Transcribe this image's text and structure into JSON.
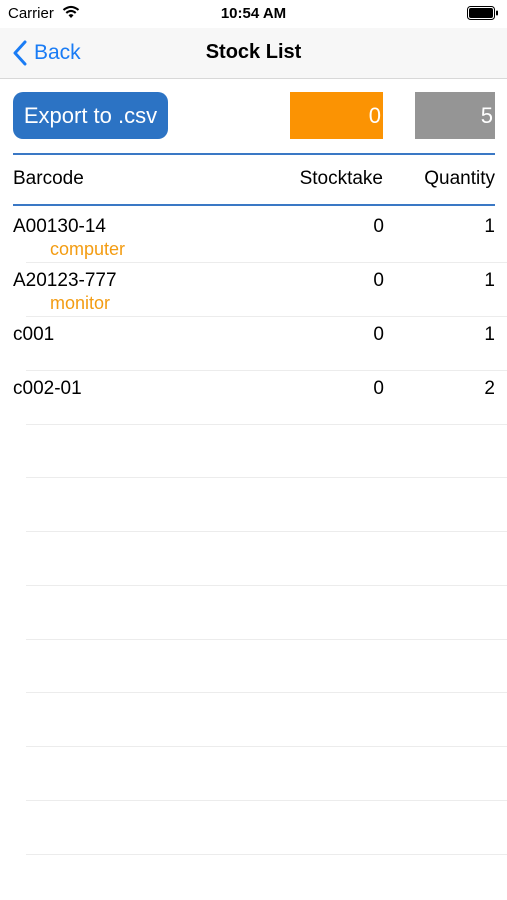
{
  "status_bar": {
    "carrier": "Carrier",
    "time": "10:54 AM"
  },
  "nav": {
    "back_label": "Back",
    "title": "Stock List"
  },
  "toolbar": {
    "export_label": "Export to .csv",
    "stocktake_total": "0",
    "quantity_total": "5"
  },
  "table": {
    "headers": {
      "barcode": "Barcode",
      "stocktake": "Stocktake",
      "quantity": "Quantity"
    },
    "rows": [
      {
        "barcode": "A00130-14",
        "description": "computer",
        "stocktake": "0",
        "quantity": "1"
      },
      {
        "barcode": "A20123-777",
        "description": "monitor",
        "stocktake": "0",
        "quantity": "1"
      },
      {
        "barcode": "c001",
        "description": "",
        "stocktake": "0",
        "quantity": "1"
      },
      {
        "barcode": "c002-01",
        "description": "",
        "stocktake": "0",
        "quantity": "2"
      }
    ]
  },
  "colors": {
    "accent": "#1a7cf5",
    "export_button": "#2c73c4",
    "stocktake_box": "#fb9303",
    "quantity_box": "#959595",
    "description_text": "#f39c12"
  }
}
